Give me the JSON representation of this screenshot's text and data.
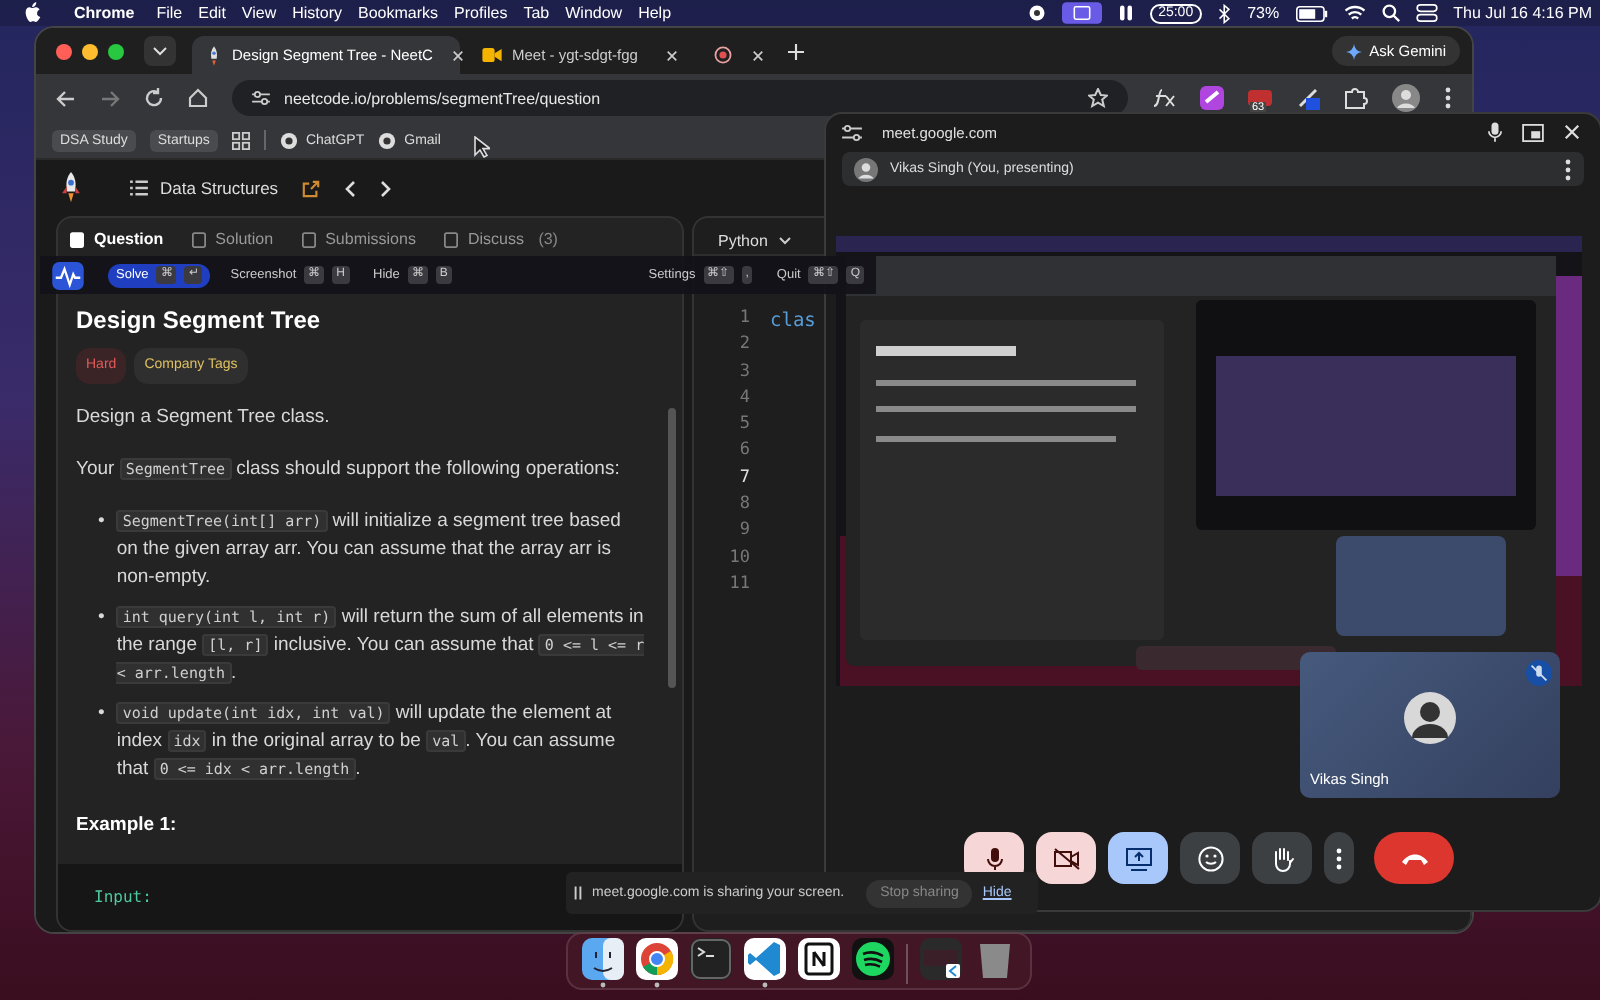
{
  "menubar": {
    "app": "Chrome",
    "menus": [
      "File",
      "Edit",
      "View",
      "History",
      "Bookmarks",
      "Profiles",
      "Tab",
      "Window",
      "Help"
    ],
    "timer": "25:00",
    "battery": "73%",
    "clock": "Thu Jul 16  4:16 PM"
  },
  "browser": {
    "tabs": [
      {
        "title": "Design Segment Tree - NeetC",
        "kind": "page",
        "selected": true
      },
      {
        "title": "Meet - ygt-sdgt-fgg",
        "kind": "meet",
        "selected": false
      }
    ],
    "gemini": "Ask Gemini",
    "address": "neetcode.io/problems/segmentTree/question",
    "extension_badge": "63",
    "bookmarks": [
      {
        "label": "DSA Study",
        "kind": "folder"
      },
      {
        "label": "Startups",
        "kind": "folder"
      },
      {
        "label": "ChatGPT",
        "kind": "link"
      },
      {
        "label": "Gmail",
        "kind": "link"
      }
    ]
  },
  "page": {
    "breadcrumb": "Data Structures",
    "tabs": [
      {
        "label": "Question",
        "selected": true
      },
      {
        "label": "Solution",
        "selected": false
      },
      {
        "label": "Submissions",
        "selected": false
      },
      {
        "label": "Discuss",
        "count": "(3)",
        "selected": false
      }
    ],
    "title": "Design Segment Tree",
    "difficulty": "Hard",
    "tag": "Company Tags",
    "paragraphs": [
      [
        {
          "text": "Design a Segment Tree class.",
          "kind": "text"
        }
      ],
      [
        {
          "text": "Your ",
          "kind": "text"
        },
        {
          "text": "SegmentTree",
          "kind": "code"
        },
        {
          "text": " class should support the following operations:",
          "kind": "text"
        }
      ]
    ],
    "bullets": [
      {
        "marker": "•",
        "parts": [
          {
            "text": "SegmentTree(int[] arr)",
            "kind": "code"
          },
          {
            "text": " will initialize a segment tree based on the given array arr. You can assume that the array arr is non-empty.",
            "kind": "text"
          }
        ]
      },
      {
        "marker": "•",
        "parts": [
          {
            "text": "int query(int l, int r)",
            "kind": "code"
          },
          {
            "text": " will return the sum of all elements in the range ",
            "kind": "text"
          },
          {
            "text": "[l, r]",
            "kind": "code"
          },
          {
            "text": " inclusive. You can assume that ",
            "kind": "text"
          },
          {
            "text": "0 <= l <= r < arr.length",
            "kind": "code"
          },
          {
            "text": ".",
            "kind": "text"
          }
        ]
      },
      {
        "marker": "•",
        "parts": [
          {
            "text": "void update(int idx, int val)",
            "kind": "code"
          },
          {
            "text": " will update the element at index ",
            "kind": "text"
          },
          {
            "text": "idx",
            "kind": "code"
          },
          {
            "text": " in the original array to be ",
            "kind": "text"
          },
          {
            "text": "val",
            "kind": "code"
          },
          {
            "text": ". You can assume that ",
            "kind": "text"
          },
          {
            "text": "0 <= idx < arr.length",
            "kind": "code"
          },
          {
            "text": ".",
            "kind": "text"
          }
        ]
      }
    ],
    "example_heading": "Example 1:",
    "example_label": "Input:",
    "editor": {
      "language": "Python",
      "code": "clas",
      "lines": [
        {
          "number": "1",
          "current": false
        },
        {
          "number": "2",
          "current": false
        },
        {
          "number": "3",
          "current": false
        },
        {
          "number": "4",
          "current": false
        },
        {
          "number": "5",
          "current": false
        },
        {
          "number": "6",
          "current": false
        },
        {
          "number": "7",
          "current": true
        },
        {
          "number": "8",
          "current": false
        },
        {
          "number": "9",
          "current": false
        },
        {
          "number": "10",
          "current": false
        },
        {
          "number": "11",
          "current": false
        }
      ]
    }
  },
  "overlay": {
    "left_actions": [
      {
        "label": "Solve",
        "kind": "primary",
        "keys": [
          "⌘",
          "↵"
        ]
      },
      {
        "label": "Screenshot",
        "kind": "plain",
        "keys": [
          "⌘",
          "H"
        ]
      },
      {
        "label": "Hide",
        "kind": "plain",
        "keys": [
          "⌘",
          "B"
        ]
      }
    ],
    "right_actions": [
      {
        "label": "Settings",
        "keys": [
          "⌘⇧",
          ","
        ]
      },
      {
        "label": "Quit",
        "keys": [
          "⌘⇧",
          "Q"
        ]
      }
    ]
  },
  "meet": {
    "url": "meet.google.com",
    "presenter": "Vikas Singh (You, presenting)",
    "self_name": "Vikas Singh",
    "self_muted": true,
    "controls": [
      {
        "kind": "mic",
        "on": false
      },
      {
        "kind": "camera",
        "on": false
      },
      {
        "kind": "present",
        "on": true
      },
      {
        "kind": "emoji"
      },
      {
        "kind": "hand"
      },
      {
        "kind": "more"
      },
      {
        "kind": "end"
      }
    ]
  },
  "sharing": {
    "message": "meet.google.com is sharing your screen.",
    "stop": "Stop sharing",
    "hide": "Hide"
  },
  "dock": [
    {
      "kind": "finder",
      "running": true
    },
    {
      "kind": "chrome",
      "running": true
    },
    {
      "kind": "terminal",
      "running": false
    },
    {
      "kind": "vscode",
      "running": true
    },
    {
      "kind": "notes",
      "running": false
    },
    {
      "kind": "music",
      "running": false
    },
    {
      "kind": "window",
      "running": false
    },
    {
      "kind": "trash",
      "running": false
    }
  ]
}
